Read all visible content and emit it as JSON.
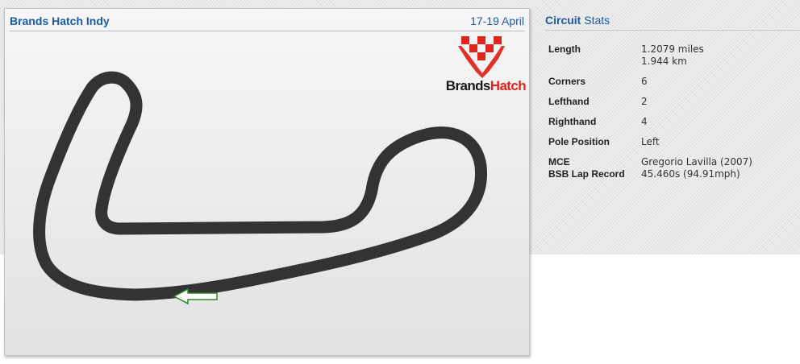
{
  "circuit": {
    "name": "Brands Hatch Indy",
    "dates": "17-19 April",
    "logo": {
      "part1": "Brands",
      "part2": "Hatch",
      "icon": "brands-hatch-logo-icon",
      "accent": "#e1251b"
    }
  },
  "stats": {
    "title_bold": "Circuit",
    "title_rest": "Stats",
    "rows": [
      {
        "label": "Length",
        "value": "1.2079 miles",
        "value2": "1.944 km"
      },
      {
        "label": "Corners",
        "value": "6"
      },
      {
        "label": "Lefthand",
        "value": "2"
      },
      {
        "label": "Righthand",
        "value": "4"
      },
      {
        "label": "Pole Position",
        "value": "Left"
      },
      {
        "label": "MCE",
        "label2": "BSB Lap Record",
        "value": "Gregorio Lavilla (2007)",
        "value2": "45.460s (94.91mph)"
      }
    ]
  },
  "colors": {
    "heading": "#1d5aa6",
    "track": "#333333",
    "arrow_border": "#2a8a2a"
  }
}
